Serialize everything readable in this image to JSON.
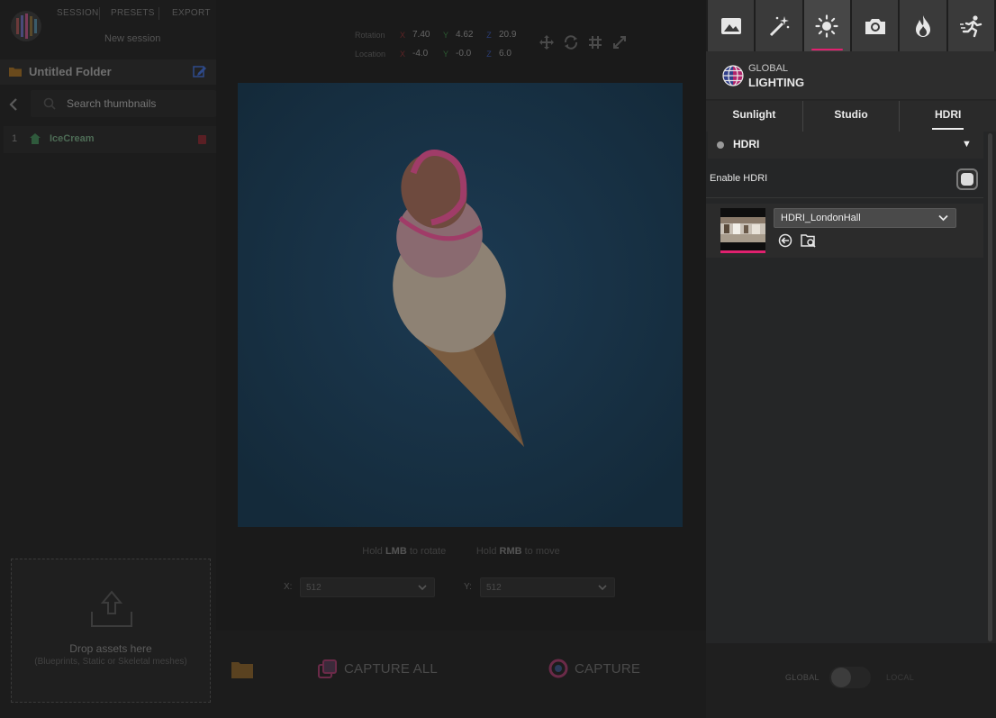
{
  "app": {
    "menu": {
      "session": "SESSION",
      "presets": "PRESETS",
      "export": "EXPORT"
    },
    "session_name": "New session"
  },
  "left": {
    "folder_name": "Untitled Folder",
    "search_placeholder": "Search thumbnails",
    "scenes": [
      {
        "index": "1",
        "name": "IceCream"
      }
    ],
    "drop": {
      "title": "Drop assets here",
      "subtitle": "(Blueprints, Static or Skeletal meshes)"
    }
  },
  "transform": {
    "rotation_label": "Rotation",
    "location_label": "Location",
    "rotation": {
      "x": "7.40",
      "y": "4.62",
      "z": "20.9"
    },
    "location": {
      "x": "-4.0",
      "y": "-0.0",
      "z": "6.0"
    },
    "axis": {
      "x": "X",
      "y": "Y",
      "z": "Z"
    }
  },
  "viewport": {
    "hint": {
      "pre1": "Hold ",
      "key1": "LMB",
      "post1": " to rotate",
      "pre2": "Hold ",
      "key2": "RMB",
      "post2": " to move"
    },
    "resolution": {
      "x_label": "X:",
      "x_value": "512",
      "y_label": "Y:",
      "y_value": "512"
    }
  },
  "capture": {
    "capture_all": "CAPTURE ALL",
    "capture": "CAPTURE"
  },
  "right": {
    "categories": [
      "image-icon",
      "magic-wand-icon",
      "sun-icon",
      "camera-icon",
      "flame-icon",
      "running-figure-icon"
    ],
    "active_category": "sun-icon",
    "section_sub": "GLOBAL",
    "section_title": "LIGHTING",
    "subtabs": [
      "Sunlight",
      "Studio",
      "HDRI"
    ],
    "active_subtab": "HDRI",
    "hdri": {
      "header": "HDRI",
      "collapse_glyph": "▼",
      "enable_label": "Enable HDRI",
      "enabled": true,
      "selected_map": "HDRI_LondonHall"
    },
    "scope": {
      "global": "GLOBAL",
      "local": "LOCAL"
    }
  },
  "colors": {
    "accent": "#e0216f",
    "panel_bg": "#262626",
    "viewport_bg": "#163042",
    "axis_x": "#c43a3a",
    "axis_y": "#3aa34a",
    "axis_z": "#3a5ec4"
  }
}
